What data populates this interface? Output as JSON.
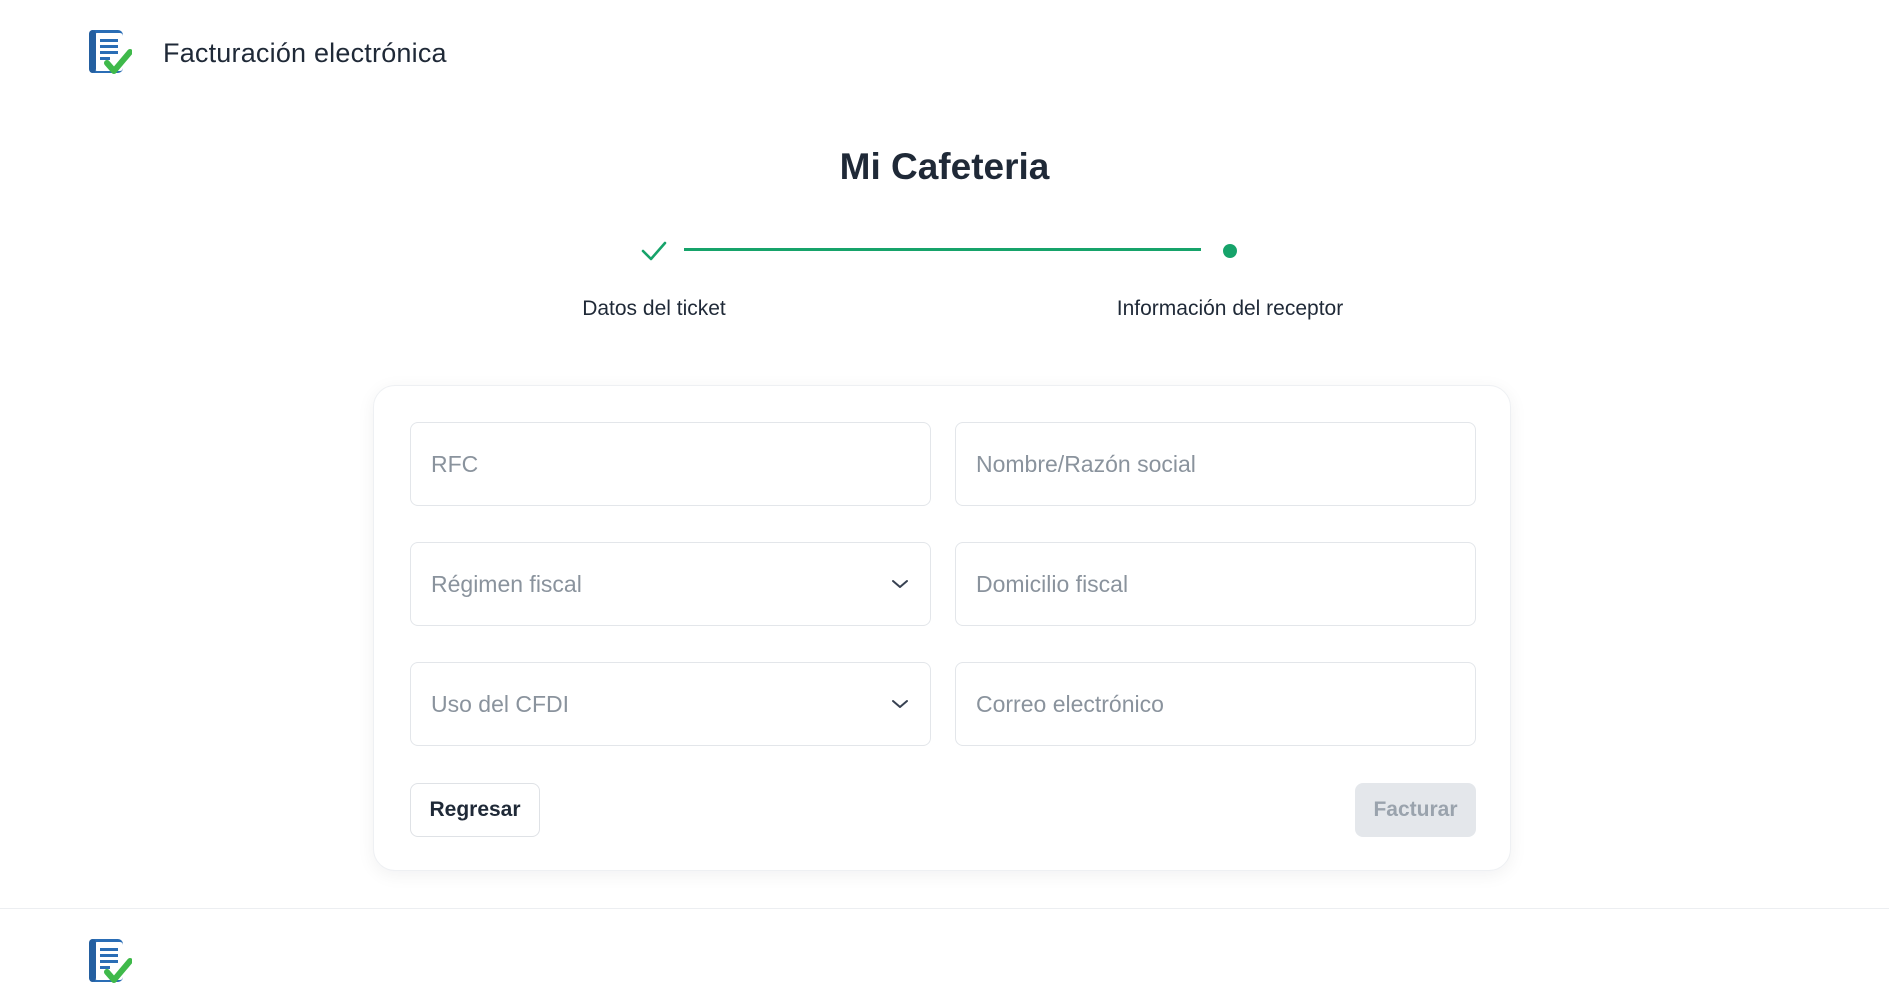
{
  "header": {
    "app_title": "Facturación electrónica",
    "logo_icon": "invoice-check-icon"
  },
  "page": {
    "title": "Mi Cafeteria"
  },
  "stepper": {
    "steps": [
      {
        "label": "Datos del ticket",
        "state": "completed"
      },
      {
        "label": "Información del receptor",
        "state": "current"
      }
    ]
  },
  "form": {
    "rfc_placeholder": "RFC",
    "nombre_placeholder": "Nombre/Razón social",
    "regimen_placeholder": "Régimen fiscal",
    "domicilio_placeholder": "Domicilio fiscal",
    "uso_cfdi_placeholder": "Uso del CFDI",
    "correo_placeholder": "Correo electrónico"
  },
  "actions": {
    "back_label": "Regresar",
    "submit_label": "Facturar"
  },
  "colors": {
    "accent": "#16a36a",
    "text": "#1f2937",
    "placeholder": "#8a939d",
    "disabled_bg": "#e4e7eb"
  }
}
